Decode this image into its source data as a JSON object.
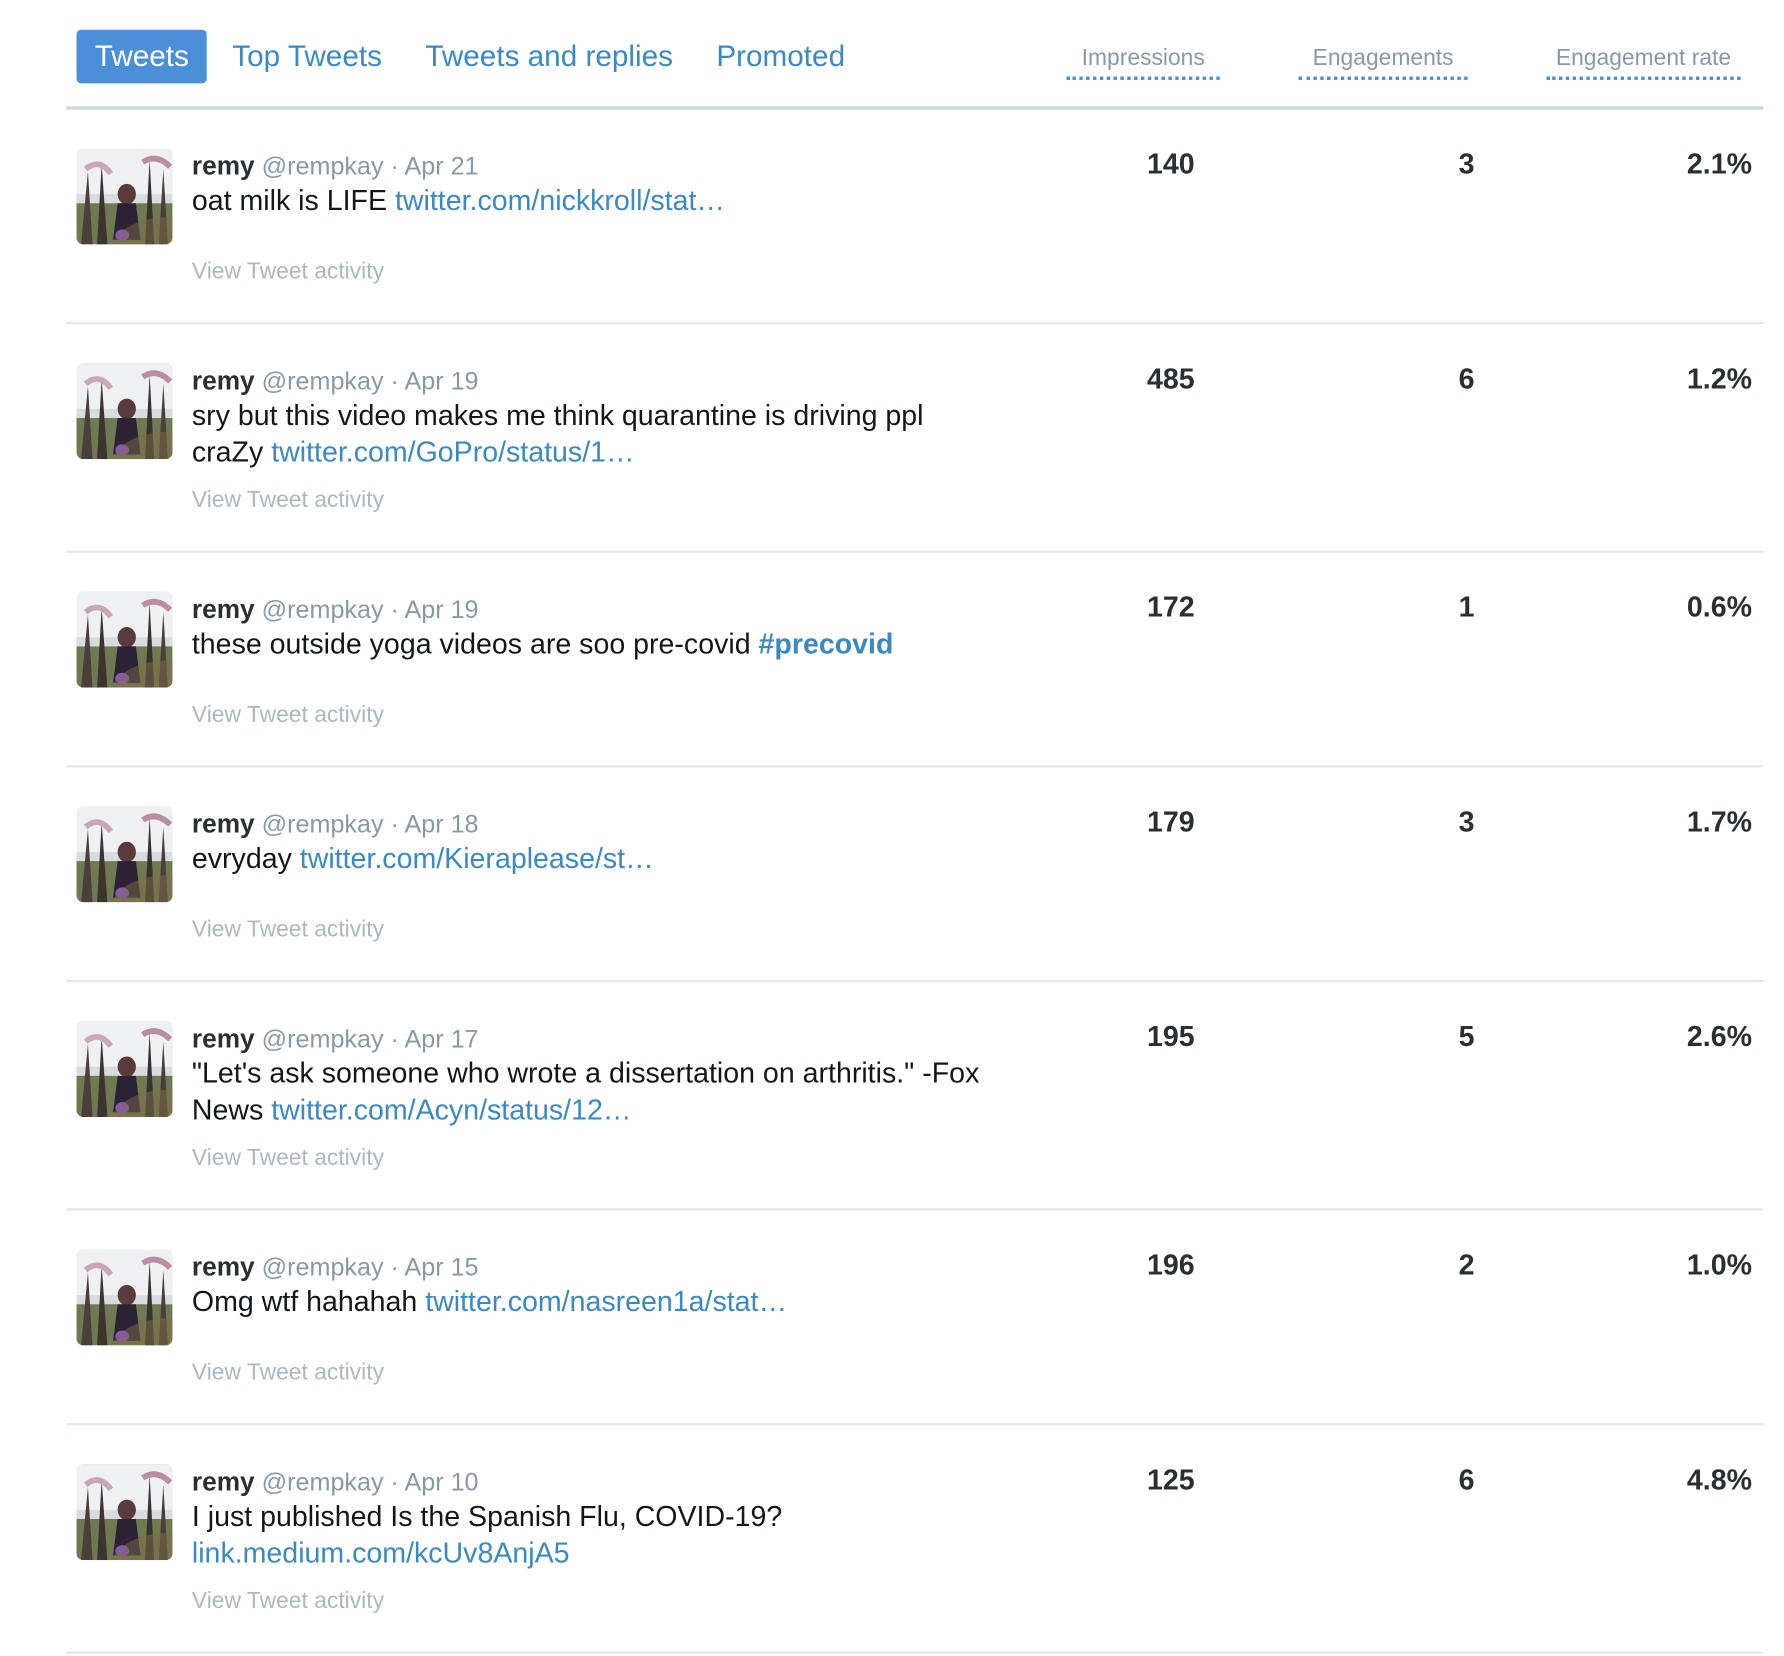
{
  "tabs": [
    {
      "label": "Tweets",
      "active": true
    },
    {
      "label": "Top Tweets",
      "active": false
    },
    {
      "label": "Tweets and replies",
      "active": false
    },
    {
      "label": "Promoted",
      "active": false
    }
  ],
  "columns": {
    "impressions": "Impressions",
    "engagements": "Engagements",
    "engagement_rate": "Engagement rate"
  },
  "colors": {
    "accent": "#4a90d9",
    "link": "#3b88c3",
    "muted": "#8899a6",
    "divider": "#e1e8ed"
  },
  "tweets": [
    {
      "name": "remy",
      "handle": "@rempkay",
      "sep": "·",
      "date": "Apr 21",
      "text": "oat milk is LIFE ",
      "link": "twitter.com/nickkroll/stat…",
      "hashtag": "",
      "activity": "View Tweet activity",
      "impressions": "140",
      "engagements": "3",
      "rate": "2.1%"
    },
    {
      "name": "remy",
      "handle": "@rempkay",
      "sep": "·",
      "date": "Apr 19",
      "text": "sry but this video makes me think quarantine is driving ppl craZy ",
      "link": "twitter.com/GoPro/status/1…",
      "hashtag": "",
      "activity": "View Tweet activity",
      "impressions": "485",
      "engagements": "6",
      "rate": "1.2%"
    },
    {
      "name": "remy",
      "handle": "@rempkay",
      "sep": "·",
      "date": "Apr 19",
      "text": "these outside yoga videos are soo pre-covid ",
      "link": "",
      "hashtag": "#precovid",
      "activity": "View Tweet activity",
      "impressions": "172",
      "engagements": "1",
      "rate": "0.6%"
    },
    {
      "name": "remy",
      "handle": "@rempkay",
      "sep": "·",
      "date": "Apr 18",
      "text": "evryday ",
      "link": "twitter.com/Kieraplease/st…",
      "hashtag": "",
      "activity": "View Tweet activity",
      "impressions": "179",
      "engagements": "3",
      "rate": "1.7%"
    },
    {
      "name": "remy",
      "handle": "@rempkay",
      "sep": "·",
      "date": "Apr 17",
      "text": "\"Let's ask someone who wrote a dissertation on arthritis.\" -Fox News ",
      "link": "twitter.com/Acyn/status/12…",
      "hashtag": "",
      "activity": "View Tweet activity",
      "impressions": "195",
      "engagements": "5",
      "rate": "2.6%"
    },
    {
      "name": "remy",
      "handle": "@rempkay",
      "sep": "·",
      "date": "Apr 15",
      "text": "Omg wtf hahahah ",
      "link": "twitter.com/nasreen1a/stat…",
      "hashtag": "",
      "activity": "View Tweet activity",
      "impressions": "196",
      "engagements": "2",
      "rate": "1.0%"
    },
    {
      "name": "remy",
      "handle": "@rempkay",
      "sep": "·",
      "date": "Apr 10",
      "text": "I just published Is the Spanish Flu, COVID-19? ",
      "link": "link.medium.com/kcUv8AnjA5",
      "hashtag": "",
      "activity": "View Tweet activity",
      "impressions": "125",
      "engagements": "6",
      "rate": "4.8%"
    }
  ]
}
